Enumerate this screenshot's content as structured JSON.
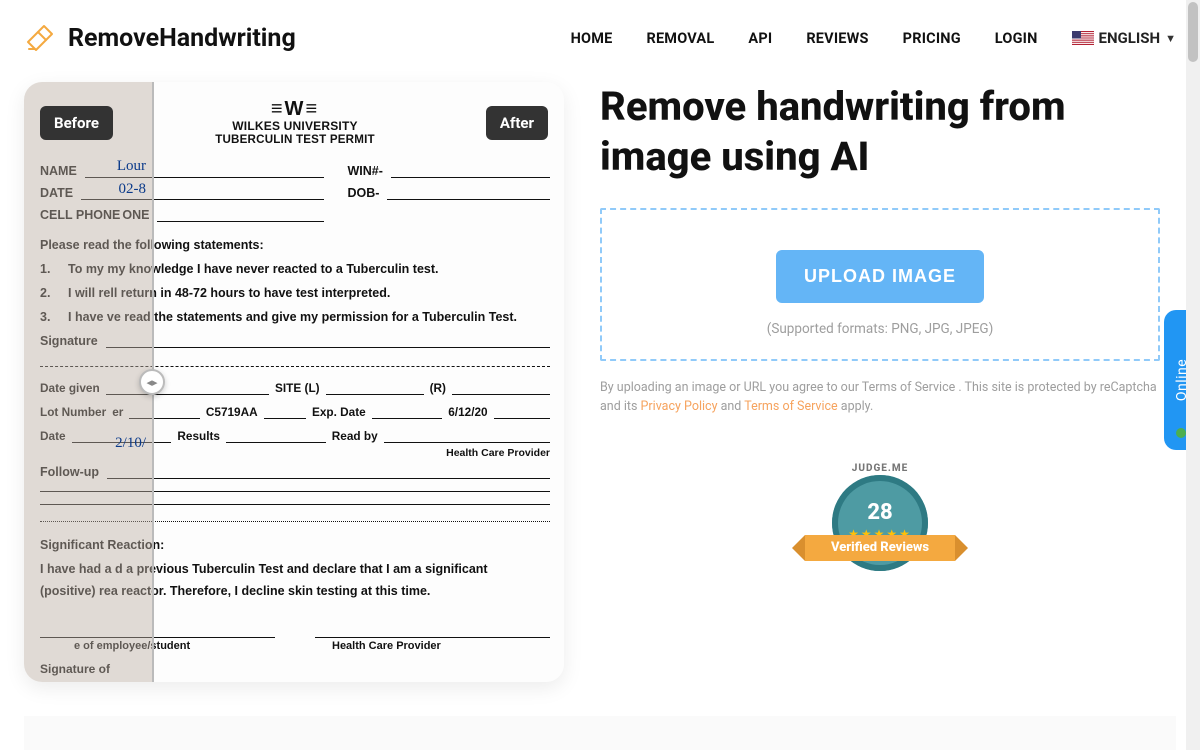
{
  "brand": "RemoveHandwriting",
  "nav": {
    "home": "HOME",
    "removal": "REMOVAL",
    "api": "API",
    "reviews": "REVIEWS",
    "pricing": "PRICING",
    "login": "LOGIN",
    "language": "ENGLISH"
  },
  "hero": {
    "title": "Remove handwriting from image using AI",
    "upload": "UPLOAD IMAGE",
    "formats": "(Supported formats: PNG, JPG, JPEG)",
    "disclaimer_pre": "By uploading an image or URL you agree to our Terms of Service . This site is protected by reCaptcha and its ",
    "privacy": "Privacy Policy",
    "and": " and ",
    "tos": "Terms of Service",
    "disclaimer_post": " apply."
  },
  "slider": {
    "before": "Before",
    "after": "After"
  },
  "doc": {
    "uni": "WILKES UNIVERSITY",
    "permit": "TUBERCULIN TEST PERMIT",
    "name": "NAME",
    "win": "WIN#-",
    "date": "DATE",
    "dob": "DOB-",
    "cell": "CELL PHONE",
    "one": "ONE",
    "read": "Please read the following statements:",
    "s1": "To my my knowledge I have never reacted to a Tuberculin test.",
    "s2": "I will rell return in 48-72 hours to have test interpreted.",
    "s3": "I have ve read the statements and give my permission for a Tuberculin Test.",
    "sig": "Signature",
    "date_given": "Date given",
    "site_l": "SITE (L)",
    "site_r": "(R)",
    "lot": "Lot Number",
    "lot_val": "C5719AA",
    "exp": "Exp. Date",
    "exp_val": "6/12/20",
    "date2": "Date",
    "results": "Results",
    "readby": "Read by",
    "hcp": "Health Care Provider",
    "followup": "Follow-up",
    "sigreact": "Significant Reaction:",
    "decl1": "I have had a  d a previous Tuberculin Test and declare that I am a significant",
    "decl2": "(positive) rea reactor.  Therefore, I decline skin testing at this time.",
    "emp": "e of employee/student",
    "sig_of": "Signature of"
  },
  "hw": {
    "name": "Lour",
    "date": "02-8",
    "date2": "2/10/"
  },
  "badge": {
    "judge": "JUDGE.ME",
    "count": "28",
    "label": "Verified Reviews"
  },
  "online": "Online"
}
